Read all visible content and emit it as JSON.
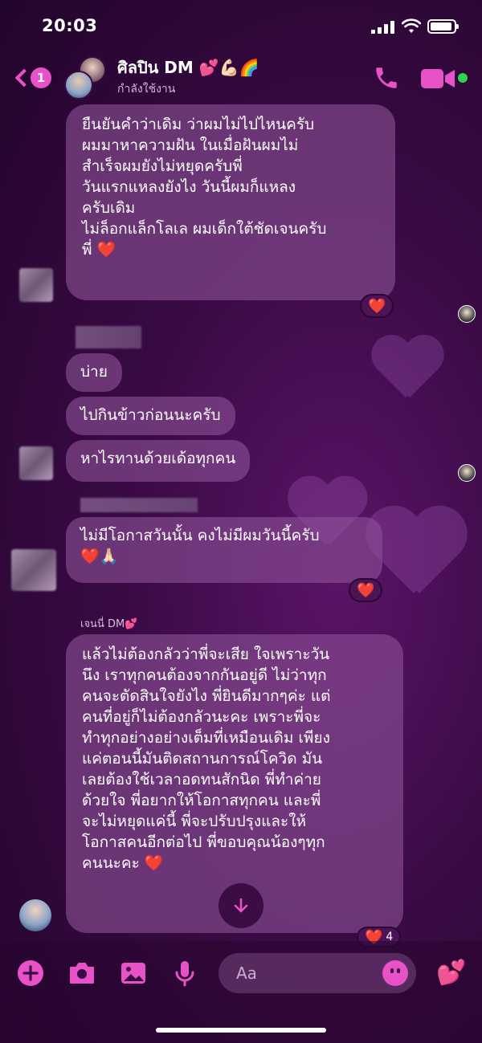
{
  "status": {
    "time": "20:03"
  },
  "header": {
    "back_badge": "1",
    "title": "ศิลปิน DM 💕💪🏻🌈",
    "subtitle": "กำลังใช้งาน"
  },
  "messages": [
    {
      "lines": [
        "ยืนยันคำว่าเดิม ว่าผมไม่ไปไหนครับ",
        "ผมมาหาความฝัน ในเมื่อฝันผมไม่",
        "สำเร็จผมยังไม่หยุดครับพี่",
        "วันแรกแหลงยังไง วันนี้ผมก็แหลง",
        "ครับเดิม",
        "ไม่ล็อกแล็กโลเล ผมเด็กใต้ชัดเจนครับ",
        "พี่ ❤️"
      ],
      "reaction": "❤️"
    },
    {
      "lines": [
        "บ่าย"
      ]
    },
    {
      "lines": [
        "ไปกินข้าวก่อนนะครับ"
      ]
    },
    {
      "lines": [
        "หาไรทานด้วยเด้อทุกคน"
      ]
    },
    {
      "lines": [
        "ไม่มีโอกาสวันนั้น คงไม่มีผมวันนี้ครับ",
        "❤️🙏🏻"
      ],
      "reaction": "❤️"
    },
    {
      "sender": "เจนนี่ DM💕",
      "lines": [
        "แล้วไม่ต้องกลัวว่าพี่จะเสีย ใจเพราะวัน",
        "นึง เราทุกคนต้องจากกันอยู่ดี ไม่ว่าทุก",
        "คนจะตัดสินใจยังไง พี่ยินดีมากๆค่ะ แต่",
        "คนที่อยู่ก็ไม่ต้องกลัวนะคะ เพราะพี่จะ",
        "ทำทุกอย่างอย่างเต็มที่เหมือนเดิม เพียง",
        "แค่ตอนนี้มันติดสถานการณ์โควิด มัน",
        "เลยต้องใช้เวลาอดทนสักนิด พี่ทำค่าย",
        "ด้วยใจ พี่อยากให้โอกาสทุกคน และพี่",
        "จะไม่หยุดแค่นี้ พี่จะปรับปรุงและให้",
        "โอกาสคนอีกต่อไป พี่ขอบคุณน้องๆทุก",
        "คนนะคะ ❤️"
      ],
      "reaction": "❤️",
      "reaction_count": "4"
    }
  ],
  "composer": {
    "placeholder": "Aa"
  },
  "colors": {
    "accent": "#e752c8",
    "online": "#2ed352",
    "heart": "#ff2a3a"
  },
  "icons": {
    "back": "chevron-left-icon",
    "call": "phone-icon",
    "video": "video-icon",
    "add": "plus-circle-icon",
    "camera": "camera-icon",
    "gallery": "image-icon",
    "mic": "microphone-icon",
    "emoji": "smiley-icon",
    "send": "hearts-icon",
    "scroll": "arrow-down-icon"
  }
}
